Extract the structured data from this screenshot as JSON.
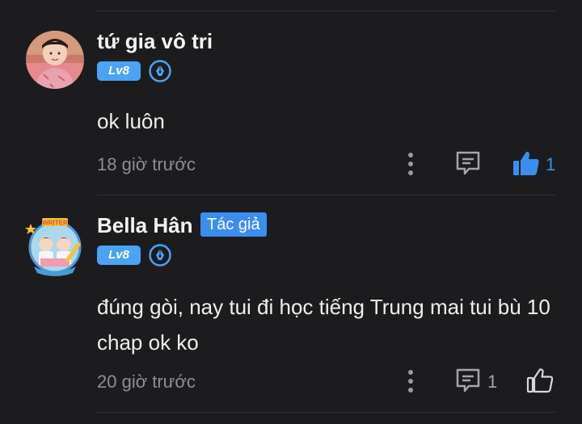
{
  "comments": [
    {
      "username": "tứ gia vô tri",
      "level": "Lv8",
      "text": "ok luôn",
      "timestamp": "18 giờ trước",
      "reply_count": "",
      "like_count": "1",
      "liked": true
    },
    {
      "username": "Bella Hân",
      "author_tag": "Tác giả",
      "level": "Lv8",
      "text": "đúng gòi, nay tui đi học tiếng Trung mai tui bù 10 chap ok ko",
      "timestamp": "20 giờ trước",
      "reply_count": "1",
      "like_count": "",
      "liked": false
    }
  ],
  "avatar_text": {
    "writer_badge": "WRITER"
  },
  "colors": {
    "background": "#1c1c1e",
    "accent_blue": "#3b8ef0",
    "level_badge": "#4ba3f5",
    "muted": "#8e8e93",
    "divider": "#2f2f31"
  },
  "icons": [
    "more-vertical-icon",
    "reply-icon",
    "thumbs-up-icon",
    "rank-pen-icon"
  ]
}
